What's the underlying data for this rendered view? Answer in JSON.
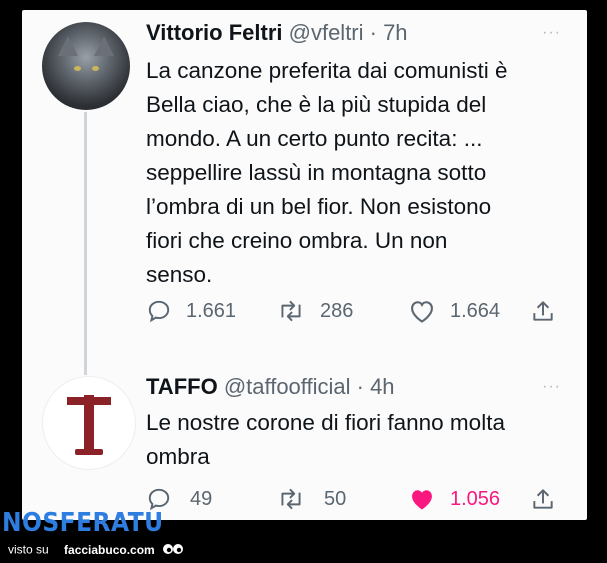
{
  "tweet1": {
    "display_name": "Vittorio Feltri",
    "handle_time": "@vfeltri · 7h",
    "more": "···",
    "text": "La canzone preferita dai comunisti è\nBella ciao, che è la più stupida del\nmondo. A un certo punto recita: ...\nseppellire lassù in montagna sotto\nl’ombra di un bel fior. Non esistono\nfiori che creino ombra. Un non\nsenso.",
    "replies": "1.661",
    "retweets": "286",
    "likes": "1.664"
  },
  "tweet2": {
    "display_name": "TAFFO",
    "handle_time": "@taffoofficial · 4h",
    "more": "···",
    "text": "Le nostre corone di fiori fanno molta\nombra",
    "replies": "49",
    "retweets": "50",
    "likes": "1.056",
    "liked_color": "#f91880"
  },
  "watermark": {
    "brand": "NOSFERATU",
    "visto_su": "visto su",
    "site": "facciabuco.com"
  },
  "colors": {
    "text": "#0f1419",
    "muted": "#5b6670",
    "brand": "#2e7de0"
  }
}
